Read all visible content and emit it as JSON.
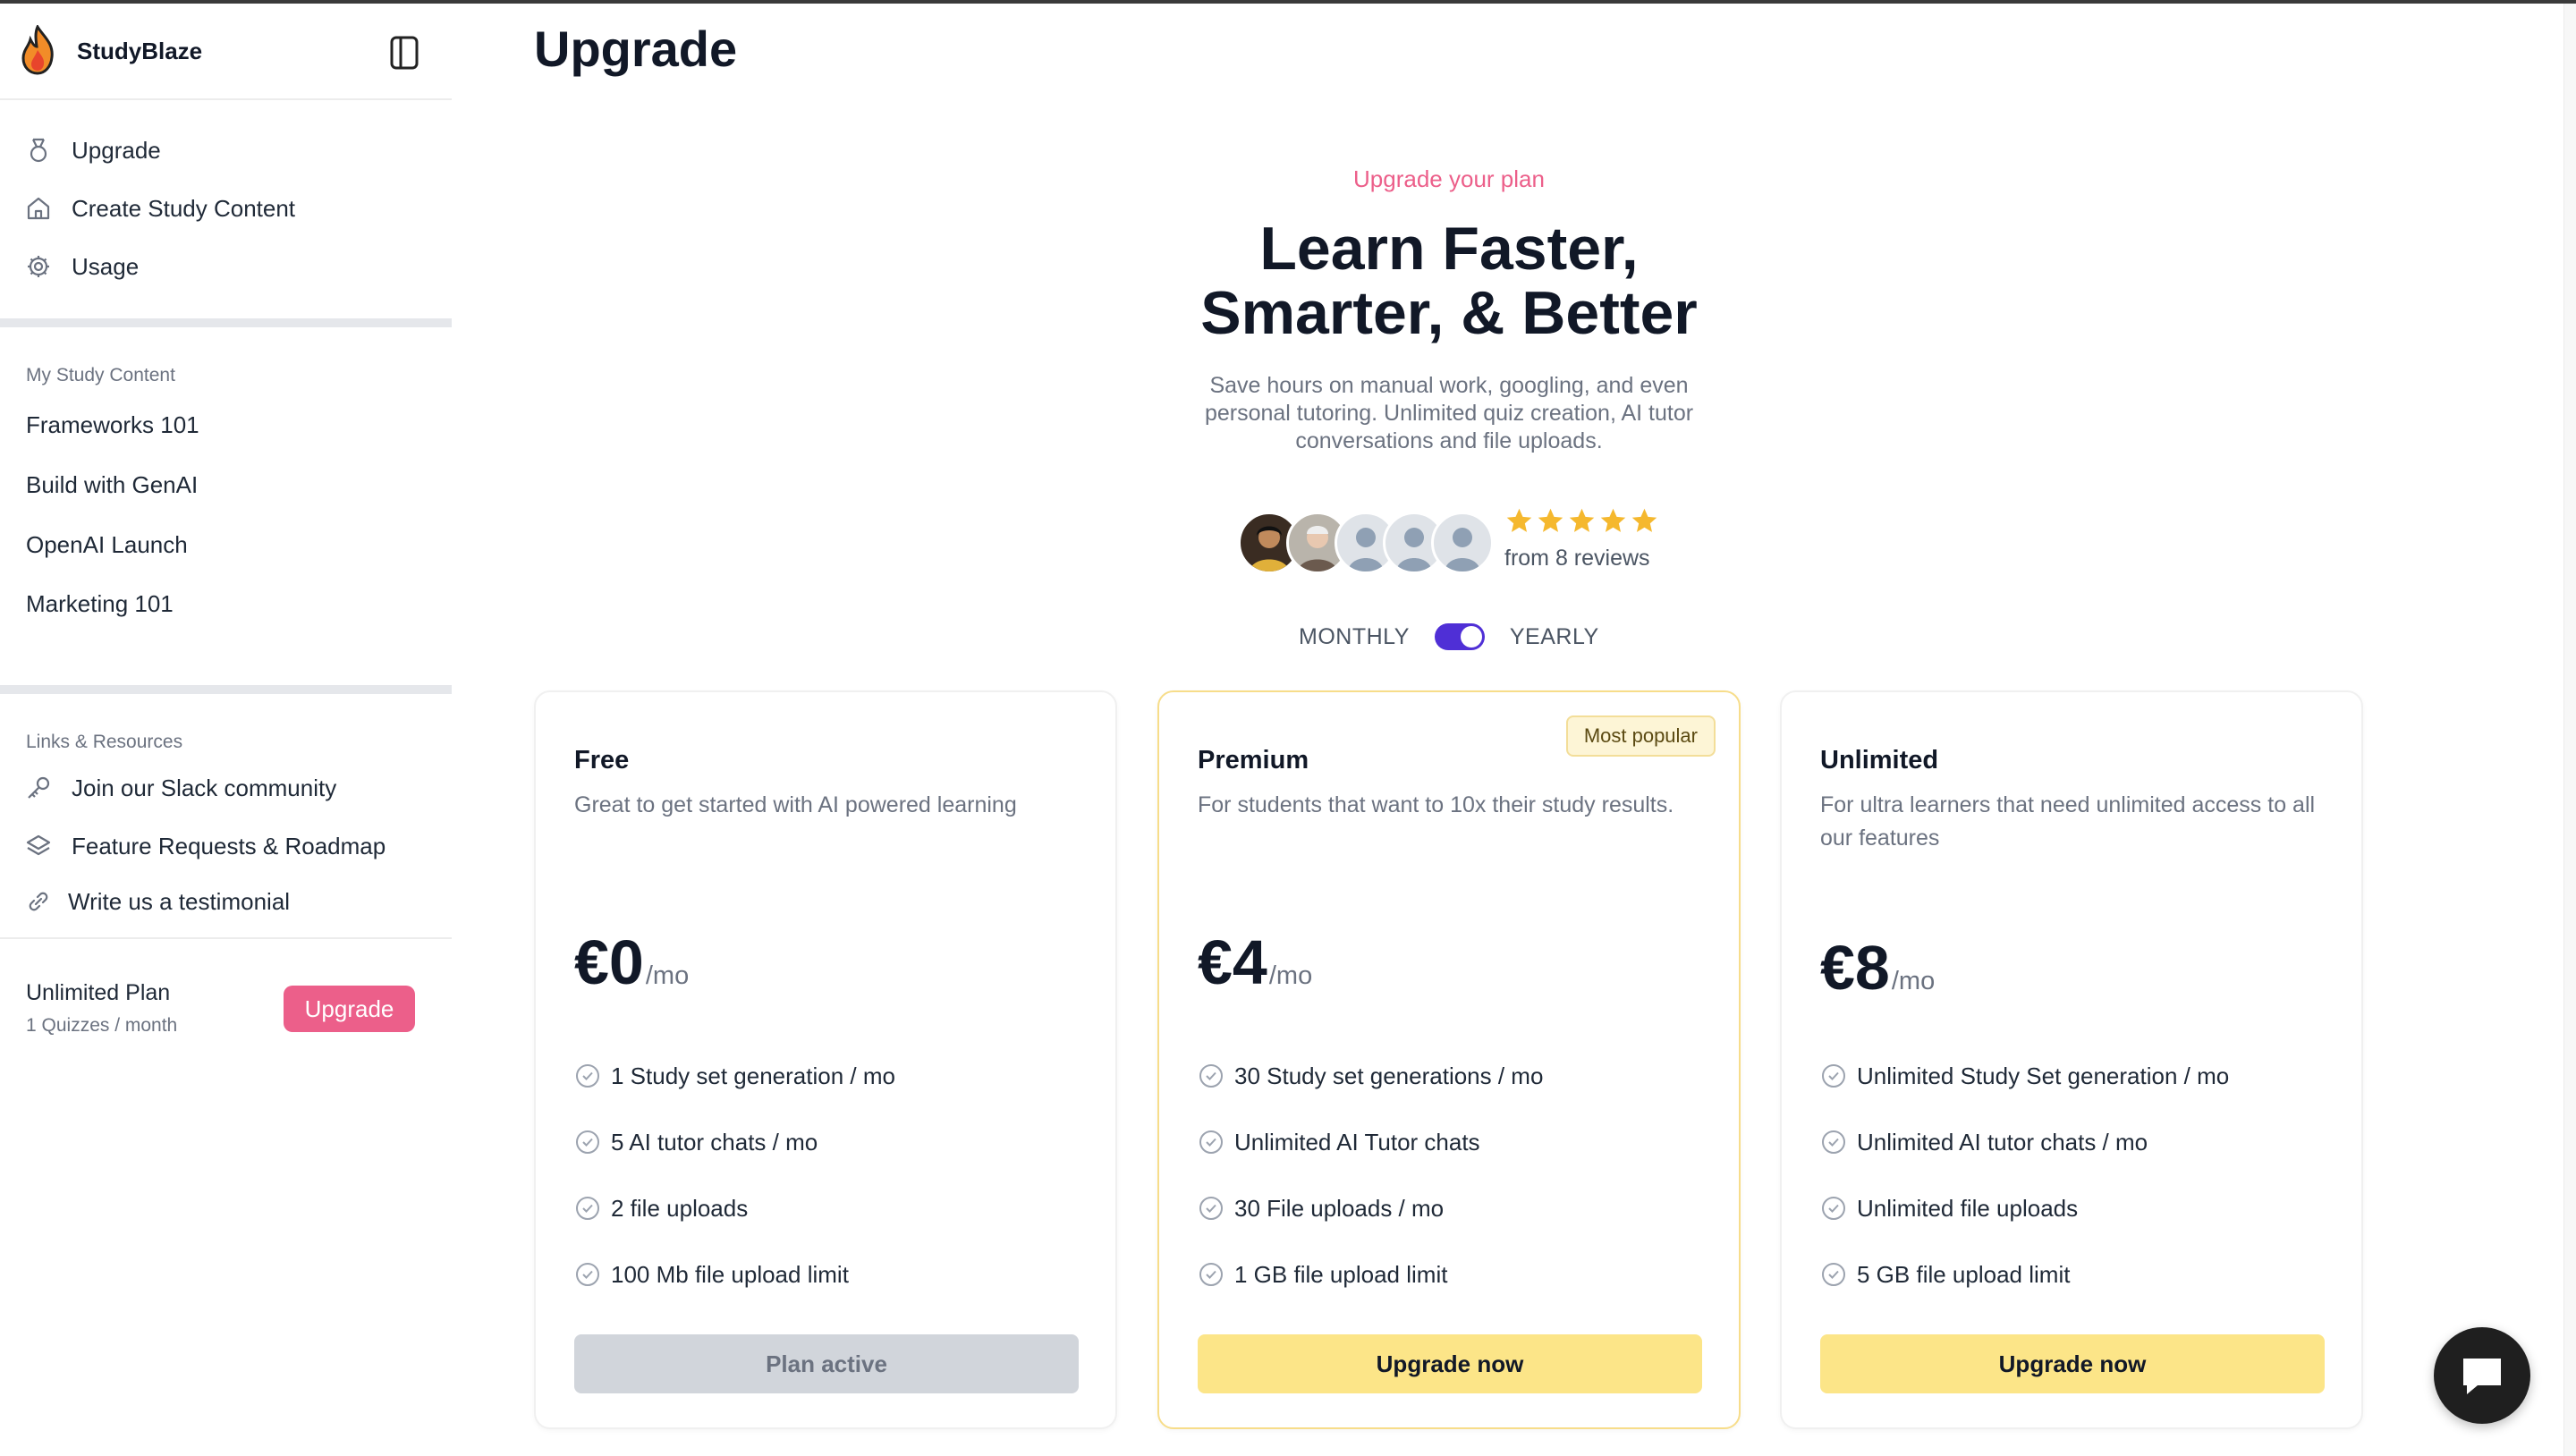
{
  "app": {
    "name": "StudyBlaze"
  },
  "sidebar": {
    "nav": [
      {
        "label": "Upgrade",
        "icon": "medal-icon"
      },
      {
        "label": "Create Study Content",
        "icon": "home-icon"
      },
      {
        "label": "Usage",
        "icon": "gear-icon"
      }
    ],
    "study_title": "My Study Content",
    "study_items": [
      "Frameworks 101",
      "Build with GenAI",
      "OpenAI Launch",
      "Marketing 101"
    ],
    "links_title": "Links & Resources",
    "links": [
      {
        "label": "Join our Slack community",
        "icon": "key-icon"
      },
      {
        "label": "Feature Requests & Roadmap",
        "icon": "layers-icon"
      },
      {
        "label": "Write us a testimonial",
        "icon": "link-icon"
      }
    ],
    "plan": {
      "name": "Unlimited Plan",
      "quota": "1 Quizzes / month",
      "button": "Upgrade"
    }
  },
  "main": {
    "title": "Upgrade",
    "eyebrow": "Upgrade your plan",
    "headline_line1": "Learn Faster,",
    "headline_line2": "Smarter, & Better",
    "subtext": "Save hours on manual work, googling, and even personal tutoring. Unlimited quiz creation, AI tutor conversations and file uploads.",
    "rating": {
      "stars": 5,
      "reviews": "from 8 reviews"
    },
    "billing": {
      "monthly": "MONTHLY",
      "yearly": "YEARLY",
      "selected": "YEARLY"
    }
  },
  "plans": [
    {
      "name": "Free",
      "desc": "Great to get started with AI powered learning",
      "price": "€0",
      "per": "/mo",
      "features": [
        "1 Study set generation / mo",
        "5 AI tutor chats / mo",
        "2 file uploads",
        "100 Mb file upload limit"
      ],
      "cta": "Plan active"
    },
    {
      "name": "Premium",
      "badge": "Most popular",
      "desc": "For students that want to 10x their study results.",
      "price": "€4",
      "per": "/mo",
      "features": [
        "30 Study set generations / mo",
        "Unlimited AI Tutor chats",
        "30 File uploads / mo",
        "1 GB file upload limit"
      ],
      "cta": "Upgrade now"
    },
    {
      "name": "Unlimited",
      "desc": "For ultra learners that need unlimited access to all our features",
      "price": "€8",
      "per": "/mo",
      "features": [
        "Unlimited Study Set generation / mo",
        "Unlimited AI tutor chats / mo",
        "Unlimited file uploads",
        "5 GB file upload limit"
      ],
      "cta": "Upgrade now"
    }
  ],
  "colors": {
    "accent_pink": "#ec5f8a",
    "toggle": "#4f2fd6",
    "cta_yellow": "#fce588",
    "star": "#f5b82e"
  }
}
